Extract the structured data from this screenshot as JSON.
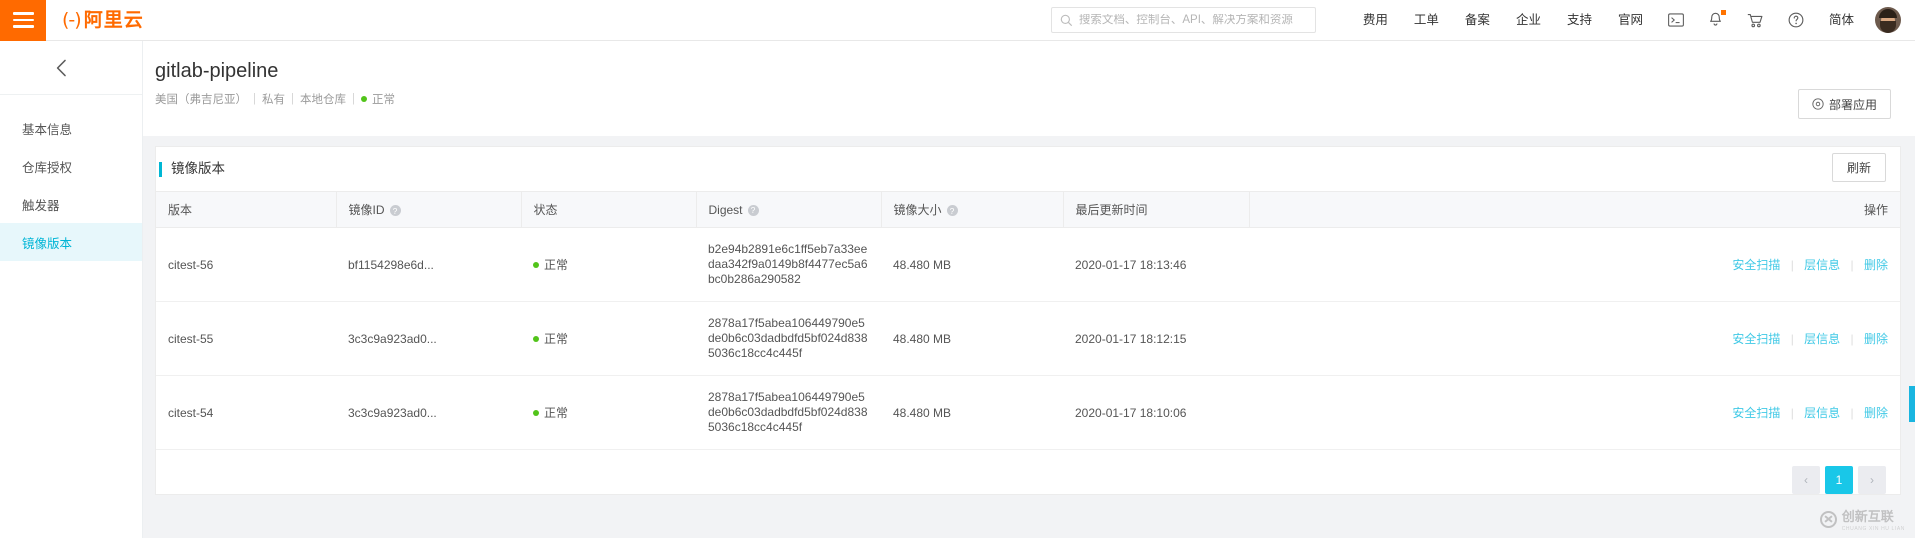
{
  "topnav": {
    "menu_icon": "hamburger-icon",
    "brand_mark": "(-)",
    "brand_text": "阿里云",
    "search": {
      "icon": "search-icon",
      "placeholder": "搜索文档、控制台、API、解决方案和资源",
      "value": ""
    },
    "links": [
      "费用",
      "工单",
      "备案",
      "企业",
      "支持",
      "官网"
    ],
    "icons": [
      {
        "name": "console-terminal-icon",
        "glyph": ">_"
      },
      {
        "name": "notification-bell-icon",
        "glyph": "bell",
        "badge": true
      },
      {
        "name": "shopping-cart-icon",
        "glyph": "cart"
      },
      {
        "name": "help-circle-icon",
        "glyph": "?"
      }
    ],
    "language": "简体",
    "avatar": "user-avatar"
  },
  "sidebar": {
    "back_icon": "chevron-left-icon",
    "items": [
      {
        "label": "基本信息",
        "active": false
      },
      {
        "label": "仓库授权",
        "active": false
      },
      {
        "label": "触发器",
        "active": false
      },
      {
        "label": "镜像版本",
        "active": true
      }
    ]
  },
  "page": {
    "title": "gitlab-pipeline",
    "meta": {
      "region": "美国（弗吉尼亚）",
      "visibility": "私有",
      "repo_type": "本地仓库",
      "status": "正常",
      "status_color": "#52c41a"
    },
    "deploy_button": "部署应用",
    "deploy_icon": "rocket-icon"
  },
  "panel": {
    "title": "镜像版本",
    "accent_color": "#00b7d4",
    "refresh_button": "刷新"
  },
  "table": {
    "columns": [
      {
        "label": "版本",
        "help": false
      },
      {
        "label": "镜像ID",
        "help": true
      },
      {
        "label": "状态",
        "help": false
      },
      {
        "label": "Digest",
        "help": true
      },
      {
        "label": "镜像大小",
        "help": true
      },
      {
        "label": "最后更新时间",
        "help": false
      },
      {
        "label": "操作",
        "help": false
      }
    ],
    "rows": [
      {
        "version": "citest-56",
        "image_id": "bf1154298e6d...",
        "status": "正常",
        "digest": "b2e94b2891e6c1ff5eb7a33eedaa342f9a0149b8f4477ec5a6bc0b286a290582",
        "size": "48.480 MB",
        "updated": "2020-01-17 18:13:46",
        "actions": [
          "安全扫描",
          "层信息",
          "删除"
        ]
      },
      {
        "version": "citest-55",
        "image_id": "3c3c9a923ad0...",
        "status": "正常",
        "digest": "2878a17f5abea106449790e5de0b6c03dadbdfd5bf024d8385036c18cc4c445f",
        "size": "48.480 MB",
        "updated": "2020-01-17 18:12:15",
        "actions": [
          "安全扫描",
          "层信息",
          "删除"
        ]
      },
      {
        "version": "citest-54",
        "image_id": "3c3c9a923ad0...",
        "status": "正常",
        "digest": "2878a17f5abea106449790e5de0b6c03dadbdfd5bf024d8385036c18cc4c445f",
        "size": "48.480 MB",
        "updated": "2020-01-17 18:10:06",
        "actions": [
          "安全扫描",
          "层信息",
          "删除"
        ]
      }
    ]
  },
  "pagination": {
    "prev": "‹",
    "next": "›",
    "pages": [
      "1"
    ],
    "current": "1",
    "active_color": "#19c7e8"
  },
  "watermark": {
    "text": "创新互联",
    "subtext": "CHUANG XIN HU LIAN"
  }
}
